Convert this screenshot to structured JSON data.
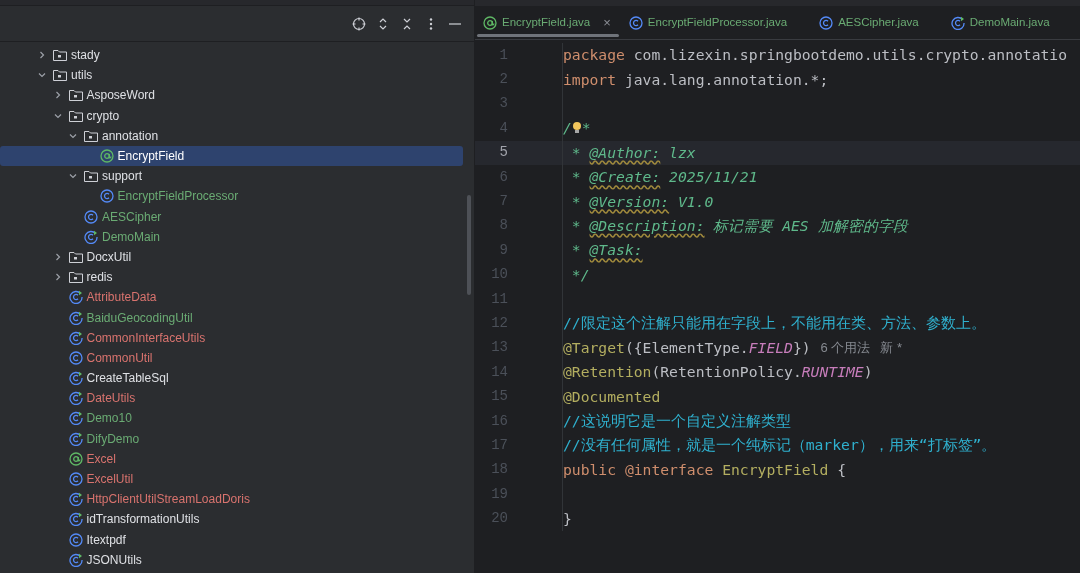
{
  "project_tree": [
    {
      "name": "stady",
      "kind": "folder",
      "color": "#dfe1e5",
      "expanded": false,
      "selected": false
    },
    {
      "name": "utils",
      "kind": "folder",
      "color": "#dfe1e5",
      "expanded": true,
      "selected": false,
      "children": [
        {
          "name": "AsposeWord",
          "kind": "folder",
          "color": "#dfe1e5",
          "expanded": false,
          "selected": false
        },
        {
          "name": "crypto",
          "kind": "folder",
          "color": "#dfe1e5",
          "expanded": true,
          "selected": false,
          "children": [
            {
              "name": "annotation",
              "kind": "folder",
              "color": "#dfe1e5",
              "expanded": true,
              "selected": false,
              "children": [
                {
                  "name": "EncryptField",
                  "kind": "annotation",
                  "selected": true
                }
              ]
            },
            {
              "name": "support",
              "kind": "folder",
              "color": "#dfe1e5",
              "expanded": true,
              "selected": false,
              "children": [
                {
                  "name": "EncryptFieldProcessor",
                  "kind": "class",
                  "color": "#6aab73",
                  "selected": false
                }
              ]
            },
            {
              "name": "AESCipher",
              "kind": "class",
              "color": "#6aab73",
              "selected": false
            },
            {
              "name": "DemoMain",
              "kind": "runnable",
              "color": "#6aab73",
              "selected": false
            }
          ]
        },
        {
          "name": "DocxUtil",
          "kind": "folder",
          "color": "#dfe1e5",
          "expanded": false,
          "selected": false
        },
        {
          "name": "redis",
          "kind": "folder",
          "color": "#dfe1e5",
          "expanded": false,
          "selected": false
        },
        {
          "name": "AttributeData",
          "kind": "runnable",
          "color": "#d9736e",
          "selected": false
        },
        {
          "name": "BaiduGeocodingUtil",
          "kind": "runnable",
          "color": "#6aab73",
          "selected": false
        },
        {
          "name": "CommonInterfaceUtils",
          "kind": "runnable",
          "color": "#d9736e",
          "selected": false
        },
        {
          "name": "CommonUtil",
          "kind": "class",
          "color": "#d9736e",
          "selected": false
        },
        {
          "name": "CreateTableSql",
          "kind": "runnable",
          "color": "#dfe1e5",
          "selected": false
        },
        {
          "name": "DateUtils",
          "kind": "runnable",
          "color": "#d9736e",
          "selected": false
        },
        {
          "name": "Demo10",
          "kind": "runnable",
          "color": "#6aab73",
          "selected": false
        },
        {
          "name": "DifyDemo",
          "kind": "runnable",
          "color": "#6aab73",
          "selected": false
        },
        {
          "name": "Excel",
          "kind": "annotation",
          "color": "#d9736e",
          "selected": false
        },
        {
          "name": "ExcelUtil",
          "kind": "class",
          "color": "#d9736e",
          "selected": false
        },
        {
          "name": "HttpClientUtilStreamLoadDoris",
          "kind": "runnable",
          "color": "#d9736e",
          "selected": false
        },
        {
          "name": "idTransformationUtils",
          "kind": "runnable",
          "color": "#dfe1e5",
          "selected": false
        },
        {
          "name": "Itextpdf",
          "kind": "class",
          "color": "#dfe1e5",
          "selected": false
        },
        {
          "name": "JSONUtils",
          "kind": "runnable",
          "color": "#dfe1e5",
          "selected": false
        }
      ]
    }
  ],
  "tabs": [
    {
      "label": "EncryptField.java",
      "kind": "annotation",
      "selected": true,
      "closable": true
    },
    {
      "label": "EncryptFieldProcessor.java",
      "kind": "class",
      "selected": false,
      "closable": false
    },
    {
      "label": "AESCipher.java",
      "kind": "class",
      "selected": false,
      "closable": false
    },
    {
      "label": "DemoMain.java",
      "kind": "runnable",
      "selected": false,
      "closable": false
    }
  ],
  "close_tab": "×",
  "code_lines": [
    {
      "number": "1",
      "current": false,
      "tokens": [
        {
          "kind": "kw",
          "text": "package"
        },
        {
          "kind": "plain",
          "text": " com.lizexin.springbootdemo.utils.crypto.annotatio"
        }
      ]
    },
    {
      "number": "2",
      "current": false,
      "tokens": [
        {
          "kind": "kw",
          "text": "import"
        },
        {
          "kind": "plain",
          "text": " java.lang.annotation.*;"
        }
      ]
    },
    {
      "number": "3",
      "current": false
    },
    {
      "number": "4",
      "current": false,
      "tokens": [
        {
          "kind": "doc",
          "text": "/"
        },
        {
          "kind": "bulb"
        },
        {
          "kind": "doc",
          "text": "*"
        }
      ]
    },
    {
      "number": "5",
      "current": true,
      "tokens": [
        {
          "kind": "doc",
          "text": " * "
        },
        {
          "kind": "doctag",
          "text": "@Author:"
        },
        {
          "kind": "doc",
          "text": " lzx"
        }
      ]
    },
    {
      "number": "6",
      "current": false,
      "tokens": [
        {
          "kind": "doc",
          "text": " * "
        },
        {
          "kind": "doctag",
          "text": "@Create:"
        },
        {
          "kind": "doc",
          "text": " 2025/11/21"
        }
      ]
    },
    {
      "number": "7",
      "current": false,
      "tokens": [
        {
          "kind": "doc",
          "text": " * "
        },
        {
          "kind": "doctag",
          "text": "@Version:"
        },
        {
          "kind": "doc",
          "text": " V1.0"
        }
      ]
    },
    {
      "number": "8",
      "current": false,
      "tokens": [
        {
          "kind": "doc",
          "text": " * "
        },
        {
          "kind": "doctag",
          "text": "@Description:"
        },
        {
          "kind": "doc",
          "text": " 标记需要 AES 加解密的字段"
        }
      ]
    },
    {
      "number": "9",
      "current": false,
      "tokens": [
        {
          "kind": "doc",
          "text": " * "
        },
        {
          "kind": "doctag",
          "text": "@Task:"
        }
      ]
    },
    {
      "number": "10",
      "current": false,
      "tokens": [
        {
          "kind": "doc",
          "text": " */"
        }
      ]
    },
    {
      "number": "11",
      "current": false
    },
    {
      "number": "12",
      "current": false,
      "tokens": [
        {
          "kind": "comment",
          "text": "//限定这个注解只能用在字段上，不能用在类、方法、参数上。"
        }
      ]
    },
    {
      "number": "13",
      "current": false,
      "tokens": [
        {
          "kind": "ann",
          "text": "@Target"
        },
        {
          "kind": "plain",
          "text": "({ElementType."
        },
        {
          "kind": "const",
          "text": "FIELD"
        },
        {
          "kind": "plain",
          "text": "})"
        },
        {
          "kind": "hint",
          "text": "6 个用法"
        },
        {
          "kind": "hint",
          "text": "新 *"
        }
      ]
    },
    {
      "number": "14",
      "current": false,
      "tokens": [
        {
          "kind": "ann",
          "text": "@Retention"
        },
        {
          "kind": "plain",
          "text": "(RetentionPolicy."
        },
        {
          "kind": "const",
          "text": "RUNTIME"
        },
        {
          "kind": "plain",
          "text": ")"
        }
      ]
    },
    {
      "number": "15",
      "current": false,
      "tokens": [
        {
          "kind": "ann",
          "text": "@Documented"
        }
      ]
    },
    {
      "number": "16",
      "current": false,
      "tokens": [
        {
          "kind": "comment",
          "text": "//这说明它是一个自定义注解类型"
        }
      ]
    },
    {
      "number": "17",
      "current": false,
      "tokens": [
        {
          "kind": "comment",
          "text": "//没有任何属性，就是一个纯标记（marker），用来“打标签”。"
        }
      ]
    },
    {
      "number": "18",
      "current": false,
      "tokens": [
        {
          "kind": "kw",
          "text": "public"
        },
        {
          "kind": "kw",
          "text": " @interface"
        },
        {
          "kind": "ann",
          "text": " EncryptField"
        },
        {
          "kind": "plain",
          "text": " {"
        }
      ]
    },
    {
      "number": "19",
      "current": false
    },
    {
      "number": "20",
      "current": false,
      "tokens": [
        {
          "kind": "plain",
          "text": "}"
        }
      ]
    }
  ]
}
